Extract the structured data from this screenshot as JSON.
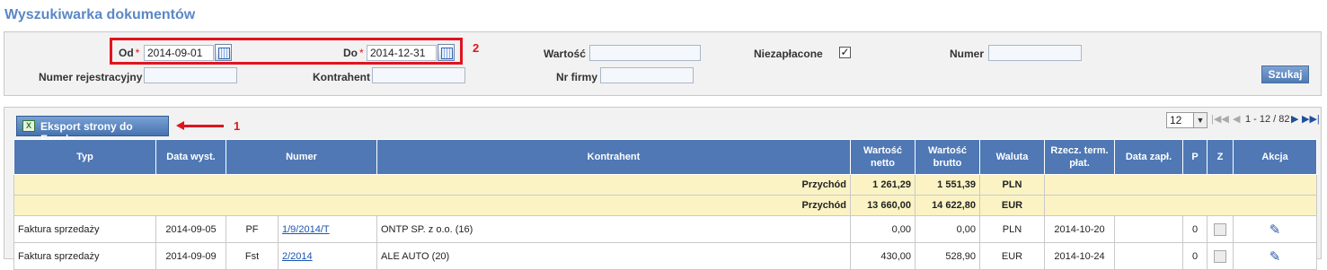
{
  "page": {
    "title": "Wyszukiwarka dokumentów"
  },
  "filters": {
    "od_label": "Od",
    "od_value": "2014-09-01",
    "do_label": "Do",
    "do_value": "2014-12-31",
    "wartosc_label": "Wartość",
    "wartosc_value": "",
    "niezaplacone_label": "Niezapłacone",
    "niezaplacone_checked": true,
    "numer_label": "Numer",
    "numer_value": "",
    "numer_rej_label": "Numer rejestracyjny",
    "numer_rej_value": "",
    "kontrahent_label": "Kontrahent",
    "kontrahent_value": "",
    "nr_firmy_label": "Nr firmy",
    "nr_firmy_value": "",
    "search_label": "Szukaj",
    "required_mark": "*"
  },
  "annotations": {
    "one": "1",
    "two": "2",
    "color": "#e0141e"
  },
  "toolbar": {
    "export_label": "Eksport strony do Excela",
    "excel_icon": "excel-icon"
  },
  "pager": {
    "page_size": "12",
    "info": "1 - 12 / 82"
  },
  "table": {
    "headers": {
      "typ": "Typ",
      "data_wyst": "Data wyst.",
      "numer": "Numer",
      "kontrahent": "Kontrahent",
      "wartosc_netto": "Wartość netto",
      "wartosc_brutto": "Wartość brutto",
      "waluta": "Waluta",
      "rzecz_term": "Rzecz. term. płat.",
      "data_zapl": "Data zapł.",
      "p": "P",
      "z": "Z",
      "akcja": "Akcja"
    },
    "summary": [
      {
        "label": "Przychód",
        "netto": "1 261,29",
        "brutto": "1 551,39",
        "waluta": "PLN"
      },
      {
        "label": "Przychód",
        "netto": "13 660,00",
        "brutto": "14 622,80",
        "waluta": "EUR"
      }
    ],
    "rows": [
      {
        "typ": "Faktura sprzedaży",
        "data": "2014-09-05",
        "prefix": "PF",
        "numer": "1/9/2014/T",
        "kontrahent": "ONTP SP. z o.o. (16)",
        "netto": "0,00",
        "brutto": "0,00",
        "waluta": "PLN",
        "termin": "2014-10-20",
        "data_zapl": "",
        "p": "0"
      },
      {
        "typ": "Faktura sprzedaży",
        "data": "2014-09-09",
        "prefix": "Fst",
        "numer": "2/2014",
        "kontrahent": "ALE AUTO (20)",
        "netto": "430,00",
        "brutto": "528,90",
        "waluta": "EUR",
        "termin": "2014-10-24",
        "data_zapl": "",
        "p": "0"
      }
    ]
  }
}
